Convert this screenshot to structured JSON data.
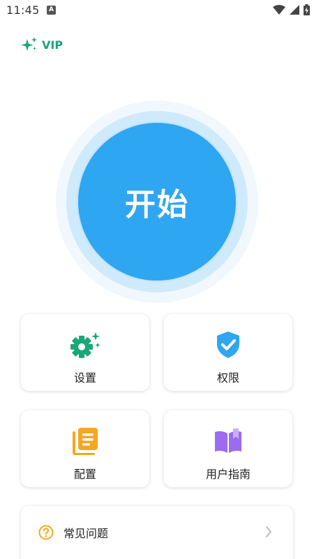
{
  "status_bar": {
    "time": "11:45",
    "notification_letter": "A"
  },
  "vip": {
    "label": "VIP",
    "icon": "sparkles-icon",
    "color": "#1aa776"
  },
  "start": {
    "label": "开始",
    "color": "#2fa6f1"
  },
  "grid": [
    {
      "id": "settings",
      "label": "设置",
      "icon": "gear-sparkle-icon",
      "color": "#1aa776"
    },
    {
      "id": "permissions",
      "label": "权限",
      "icon": "shield-check-icon",
      "color": "#2fa6f1"
    },
    {
      "id": "config",
      "label": "配置",
      "icon": "document-stack-icon",
      "color": "#f5a623"
    },
    {
      "id": "guide",
      "label": "用户指南",
      "icon": "open-book-icon",
      "color": "#9b6bf2"
    }
  ],
  "faq": {
    "label": "常见问题",
    "icon": "question-circle-icon",
    "icon_color": "#f5a623"
  }
}
